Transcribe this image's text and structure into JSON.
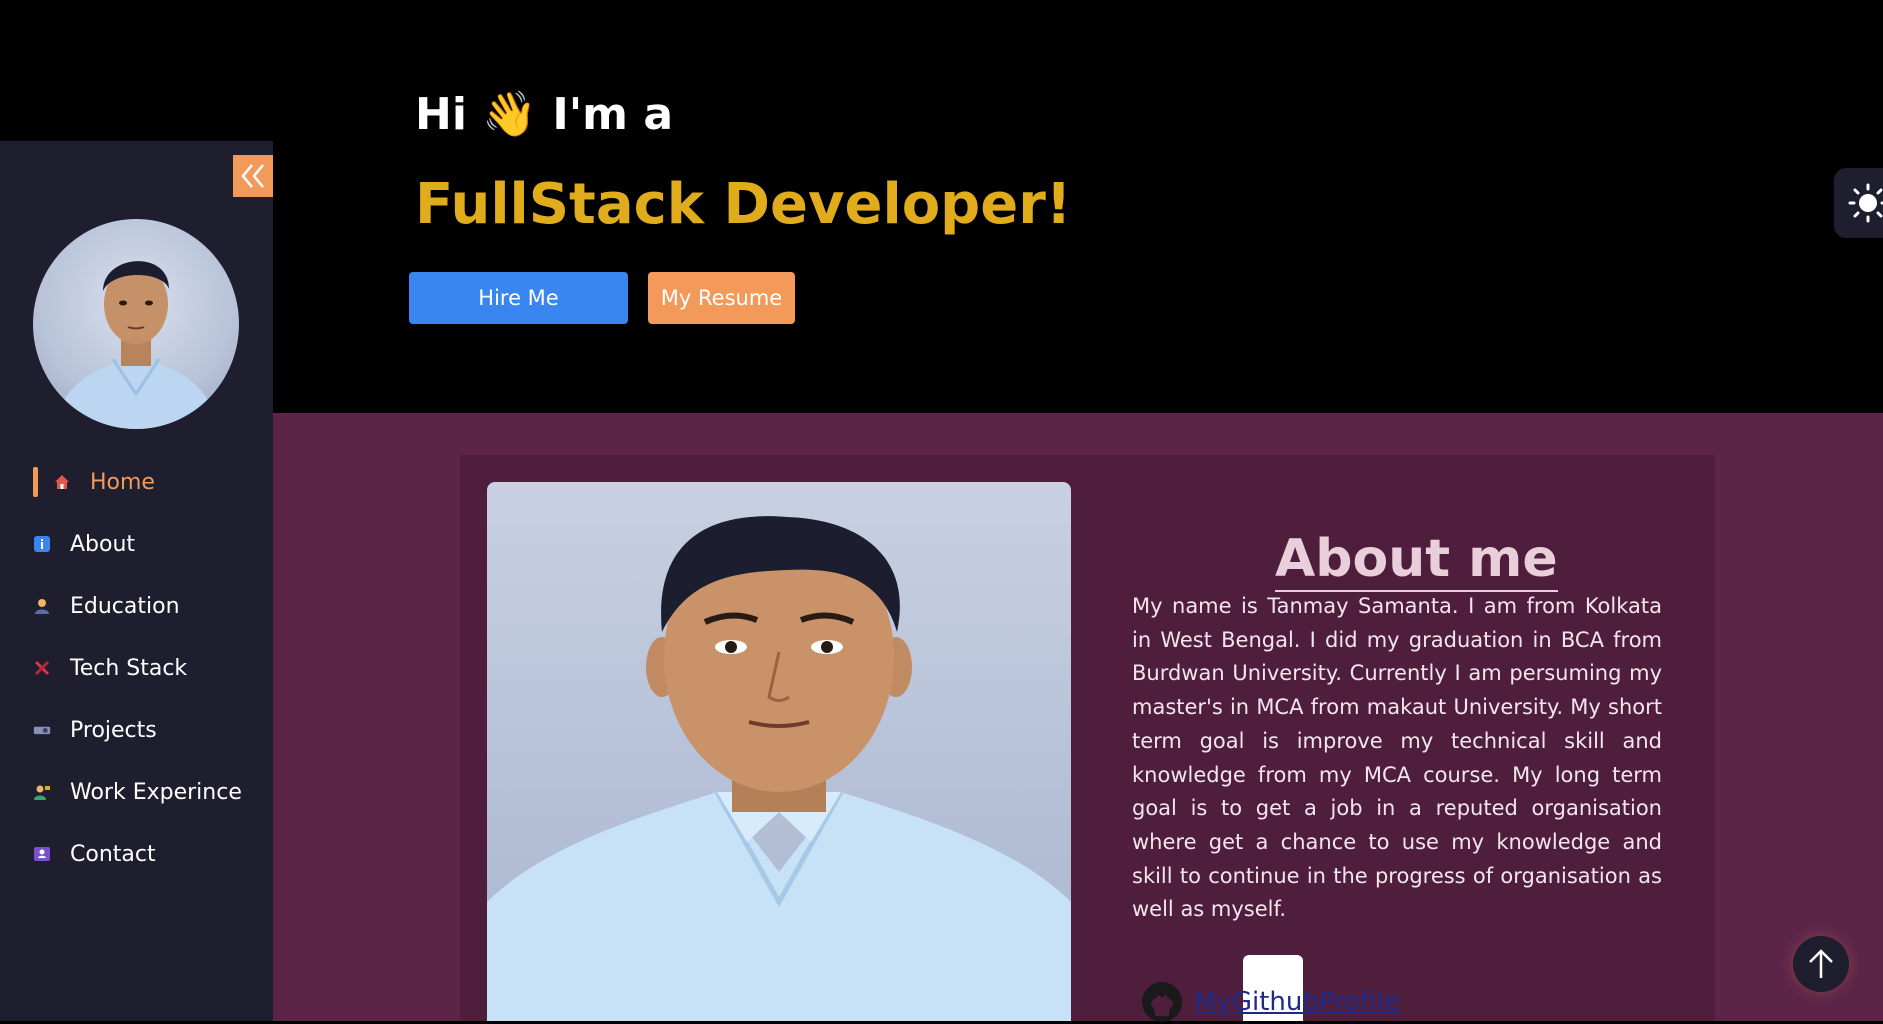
{
  "hero": {
    "greeting": "Hi 👋 I'm a",
    "title": "FullStack Developer!",
    "hire_label": "Hire Me",
    "resume_label": "My Resume"
  },
  "sidebar": {
    "collapse_icon": "double-chevron-left-icon",
    "items": [
      {
        "label": "Home",
        "icon": "home-icon",
        "color": "#e2574c"
      },
      {
        "label": "About",
        "icon": "info-icon",
        "color": "#3a86f0"
      },
      {
        "label": "Education",
        "icon": "student-icon",
        "color": "#f0b36a"
      },
      {
        "label": "Tech Stack",
        "icon": "tools-icon",
        "color": "#d6344a"
      },
      {
        "label": "Projects",
        "icon": "projector-icon",
        "color": "#8a8fb5"
      },
      {
        "label": "Work Experince",
        "icon": "worker-icon",
        "color": "#3aa86a"
      },
      {
        "label": "Contact",
        "icon": "contact-card-icon",
        "color": "#7a4fd0"
      }
    ]
  },
  "about": {
    "heading": "About me",
    "text": "My name is Tanmay Samanta. I am from Kolkata in West Bengal. I did my graduation in BCA from Burdwan University. Currently I am persuming my master's in MCA from makaut University. My short term goal is improve my technical skill and knowledge from my MCA course. My long term goal is to get a job in a reputed organisation where get a chance to use my knowledge and skill to continue in the progress of organisation as well as myself.",
    "github_label": "MyGithubProfile"
  },
  "colors": {
    "accent": "#f39a5a",
    "highlight": "#e0ac1c",
    "primary_button": "#3a86f0",
    "sidebar_bg": "#1f1e2e",
    "about_bg": "#5c2548"
  }
}
